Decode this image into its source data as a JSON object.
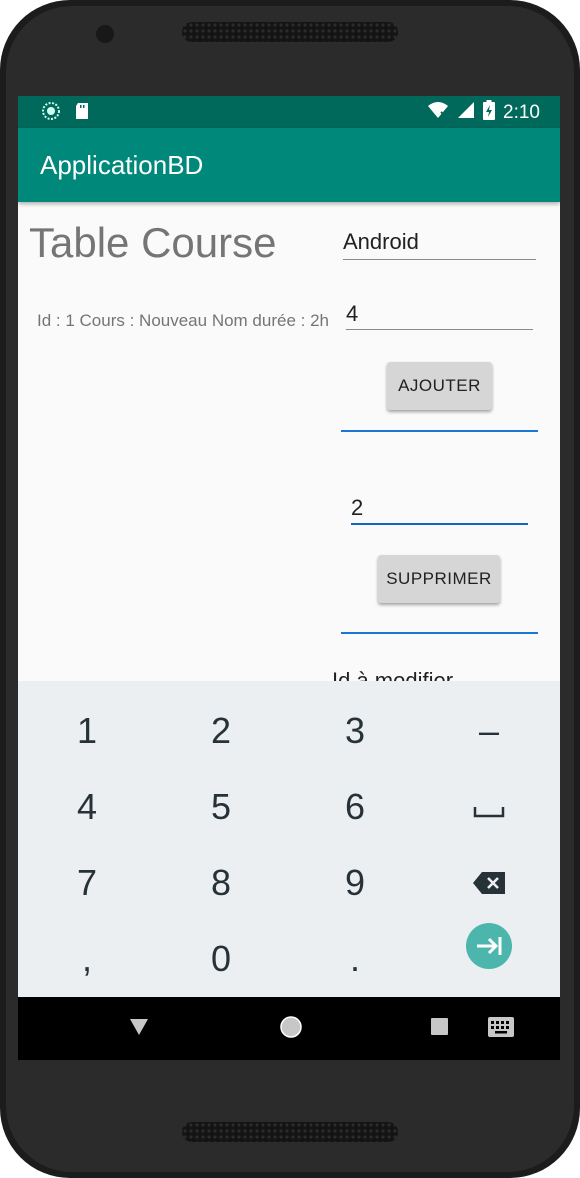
{
  "status_bar": {
    "time": "2:10",
    "icons": [
      "loading-icon",
      "sd-card-icon",
      "wifi-icon",
      "signal-icon",
      "battery-icon"
    ]
  },
  "app_bar": {
    "title": "ApplicationBD"
  },
  "main": {
    "heading": "Table Course",
    "record_text": "Id : 1 Cours : Nouveau Nom durée : 2h",
    "name_field": {
      "value": "Android"
    },
    "duration_field": {
      "value": "4"
    },
    "add_button": "AJOUTER",
    "delete_id_field": {
      "value": "2"
    },
    "delete_button": "SUPPRIMER",
    "modify_label": "Id à modifier"
  },
  "keyboard": {
    "rows": [
      [
        "1",
        "2",
        "3",
        "–"
      ],
      [
        "4",
        "5",
        "6",
        "space-icon"
      ],
      [
        "7",
        "8",
        "9",
        "backspace-icon"
      ],
      [
        ",",
        "0",
        ".",
        "next-icon"
      ]
    ],
    "accent": "#4db6ac"
  },
  "nav_bar": {
    "icons": [
      "back-icon",
      "home-icon",
      "recents-icon",
      "keyboard-switch-icon"
    ]
  },
  "colors": {
    "status_bar": "#00695c",
    "app_bar": "#00897b",
    "focus_line": "#1565c0"
  }
}
